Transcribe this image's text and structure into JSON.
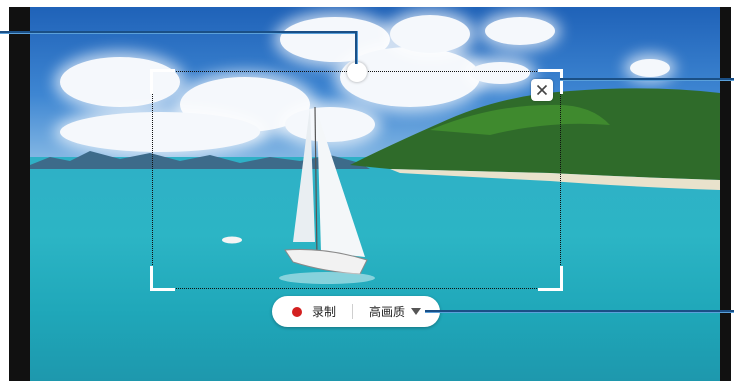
{
  "toolbar": {
    "record_label": "录制",
    "quality_label": "高画质"
  },
  "colors": {
    "callout_line": "#1a4f86",
    "record_dot": "#d32020"
  },
  "icons": {
    "close": "close-icon",
    "dropdown": "chevron-down-icon",
    "record": "record-dot-icon",
    "handle": "drag-handle-icon"
  }
}
